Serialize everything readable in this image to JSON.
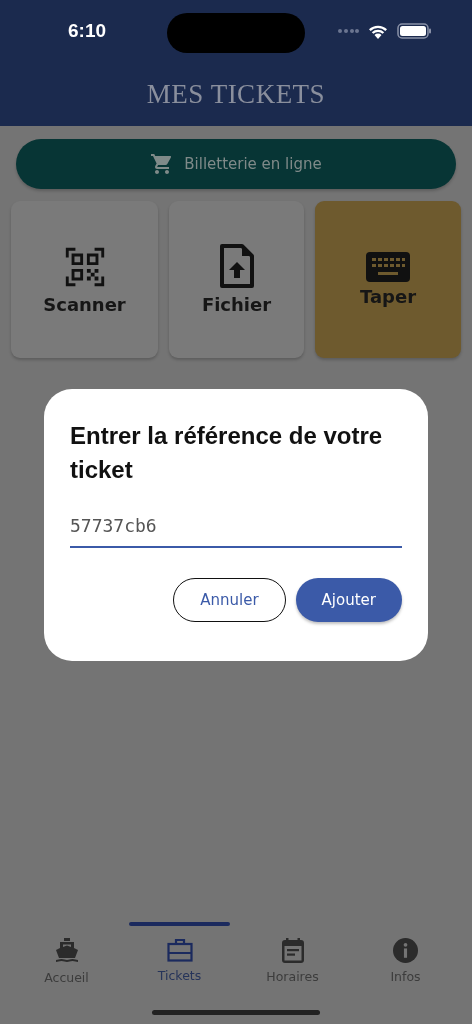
{
  "status_bar": {
    "time": "6:10"
  },
  "header": {
    "title": "MES TICKETS"
  },
  "shop_button": {
    "label": "Billetterie en ligne"
  },
  "options": [
    {
      "kind": "qr",
      "label": "Scanner",
      "selected": false
    },
    {
      "kind": "file",
      "label": "Fichier",
      "selected": false
    },
    {
      "kind": "keyboard",
      "label": "Taper",
      "selected": true
    }
  ],
  "dialog": {
    "title": "Entrer la référence de votre ticket",
    "field": {
      "value": "57737cb6"
    },
    "buttons": [
      {
        "kind": "outline",
        "label": "Annuler"
      },
      {
        "kind": "filled",
        "label": "Ajouter"
      }
    ]
  },
  "tab_bar": [
    {
      "kind": "ship",
      "label": "Accueil",
      "selected": false
    },
    {
      "kind": "briefcase",
      "label": "Tickets",
      "selected": true
    },
    {
      "kind": "calendar",
      "label": "Horaires",
      "selected": false
    },
    {
      "kind": "info",
      "label": "Infos",
      "selected": false
    }
  ]
}
